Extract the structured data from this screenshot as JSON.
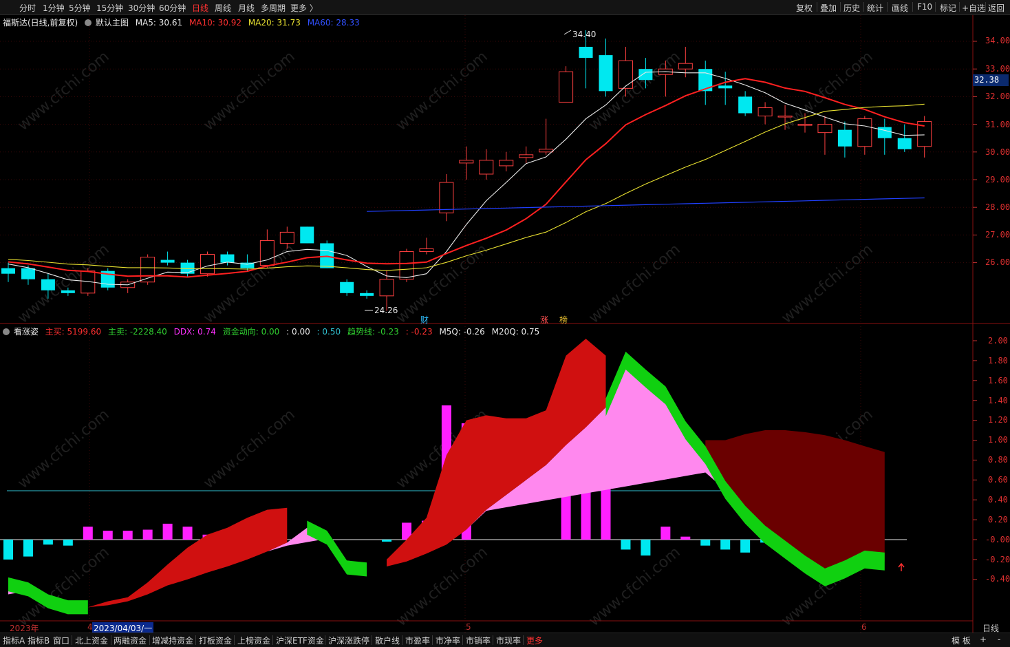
{
  "toolbar": {
    "periods": [
      "分时",
      "1分钟",
      "5分钟",
      "15分钟",
      "30分钟",
      "60分钟",
      "日线",
      "周线",
      "月线",
      "多周期",
      "更多 〉"
    ],
    "active_period": "日线",
    "right_items": [
      "复权",
      "叠加",
      "历史",
      "统计",
      "画线",
      "F10",
      "标记",
      "+自选",
      "返回"
    ]
  },
  "main_chart": {
    "stock_title": "福斯达(日线,前复权)",
    "template_label": "默认主图",
    "ma": [
      {
        "label": "MA5: 30.61",
        "color": "#e8e8e8"
      },
      {
        "label": "MA10: 30.92",
        "color": "#ff3030"
      },
      {
        "label": "MA20: 31.73",
        "color": "#e8e030"
      },
      {
        "label": "MA60: 28.33",
        "color": "#3050ff"
      }
    ],
    "high_label": "34.40",
    "low_label": "24.26",
    "current_price": "32.38",
    "price_axis": [
      "34.00",
      "33.00",
      "32.00",
      "31.00",
      "30.00",
      "29.00",
      "28.00",
      "27.00",
      "26.00"
    ],
    "markers": [
      "财",
      "涨",
      "榜"
    ]
  },
  "indicator": {
    "name": "看涨姿",
    "items": [
      {
        "label": "主买: 5199.60",
        "color": "#ff3030"
      },
      {
        "label": "主卖: -2228.40",
        "color": "#30d030"
      },
      {
        "label": "DDX: 0.74",
        "color": "#ff30ff"
      },
      {
        "label": "资金动向: 0.00",
        "color": "#30d030"
      },
      {
        "label": ": 0.00",
        "color": "#e8e8e8"
      },
      {
        "label": ": 0.50",
        "color": "#30c0d0"
      },
      {
        "label": "趋势线: -0.23",
        "color": "#30d030"
      },
      {
        "label": ": -0.23",
        "color": "#ff3030"
      },
      {
        "label": "M5Q: -0.26",
        "color": "#e8e8e8"
      },
      {
        "label": "M20Q: 0.75",
        "color": "#e8e8e8"
      }
    ],
    "axis": [
      "2.00",
      "1.80",
      "1.60",
      "1.40",
      "1.20",
      "1.00",
      "0.80",
      "0.60",
      "0.40",
      "0.20",
      "-0.00",
      "-0.20",
      "-0.40"
    ]
  },
  "dates": [
    "2023年",
    "4",
    "2023/04/03/一",
    "5",
    "6"
  ],
  "period_label": "日线",
  "bottom_tabs": [
    "指标A",
    "指标B",
    "窗口",
    "北上资金",
    "两融资金",
    "增减持资金",
    "打板资金",
    "上榜资金",
    "沪深ETF资金",
    "沪深涨跌停",
    "散户线",
    "市盈率",
    "市净率",
    "市销率",
    "市现率",
    "更多"
  ],
  "bottom_right": [
    "模 板",
    "+",
    "-"
  ],
  "watermark": "www.cfchi.com",
  "candles": [
    {
      "o": 25.8,
      "c": 25.6,
      "h": 26.0,
      "l": 25.3
    },
    {
      "o": 25.8,
      "c": 25.4,
      "h": 25.9,
      "l": 25.2
    },
    {
      "o": 25.4,
      "c": 25.0,
      "h": 25.6,
      "l": 24.7
    },
    {
      "o": 25.0,
      "c": 24.9,
      "h": 25.1,
      "l": 24.8
    },
    {
      "o": 24.9,
      "c": 25.7,
      "h": 25.8,
      "l": 24.8
    },
    {
      "o": 25.7,
      "c": 25.1,
      "h": 25.8,
      "l": 25.0
    },
    {
      "o": 25.1,
      "c": 25.3,
      "h": 25.4,
      "l": 24.9
    },
    {
      "o": 25.3,
      "c": 26.2,
      "h": 26.3,
      "l": 25.2
    },
    {
      "o": 26.1,
      "c": 26.0,
      "h": 26.4,
      "l": 25.9
    },
    {
      "o": 26.0,
      "c": 25.6,
      "h": 26.1,
      "l": 25.5
    },
    {
      "o": 25.6,
      "c": 26.3,
      "h": 26.4,
      "l": 25.5
    },
    {
      "o": 26.3,
      "c": 26.0,
      "h": 26.4,
      "l": 25.9
    },
    {
      "o": 26.0,
      "c": 25.8,
      "h": 26.3,
      "l": 25.7
    },
    {
      "o": 25.9,
      "c": 26.8,
      "h": 27.2,
      "l": 25.8
    },
    {
      "o": 26.7,
      "c": 27.1,
      "h": 27.3,
      "l": 26.5
    },
    {
      "o": 27.3,
      "c": 26.7,
      "h": 27.3,
      "l": 26.7
    },
    {
      "o": 26.7,
      "c": 25.8,
      "h": 26.8,
      "l": 25.8
    },
    {
      "o": 25.3,
      "c": 24.9,
      "h": 25.4,
      "l": 24.8
    },
    {
      "o": 24.9,
      "c": 24.8,
      "h": 25.0,
      "l": 24.7
    },
    {
      "o": 24.8,
      "c": 25.4,
      "h": 25.7,
      "l": 24.26
    },
    {
      "o": 25.4,
      "c": 26.4,
      "h": 26.5,
      "l": 25.3
    },
    {
      "o": 26.4,
      "c": 26.5,
      "h": 26.9,
      "l": 26.3
    },
    {
      "o": 27.8,
      "c": 28.9,
      "h": 29.2,
      "l": 27.5
    },
    {
      "o": 29.6,
      "c": 29.7,
      "h": 30.2,
      "l": 29.0
    },
    {
      "o": 29.2,
      "c": 29.7,
      "h": 30.1,
      "l": 29.0
    },
    {
      "o": 29.5,
      "c": 29.7,
      "h": 30.0,
      "l": 29.3
    },
    {
      "o": 29.8,
      "c": 29.9,
      "h": 30.2,
      "l": 29.6
    },
    {
      "o": 30.0,
      "c": 30.1,
      "h": 31.2,
      "l": 29.9
    },
    {
      "o": 31.8,
      "c": 32.9,
      "h": 33.1,
      "l": 31.8
    },
    {
      "o": 33.8,
      "c": 33.4,
      "h": 34.4,
      "l": 32.3
    },
    {
      "o": 33.5,
      "c": 32.2,
      "h": 34.1,
      "l": 32.0
    },
    {
      "o": 32.3,
      "c": 33.3,
      "h": 33.8,
      "l": 32.0
    },
    {
      "o": 33.0,
      "c": 32.6,
      "h": 33.4,
      "l": 32.3
    },
    {
      "o": 32.8,
      "c": 33.0,
      "h": 33.3,
      "l": 32.0
    },
    {
      "o": 33.0,
      "c": 33.2,
      "h": 33.8,
      "l": 32.7
    },
    {
      "o": 33.0,
      "c": 32.2,
      "h": 33.3,
      "l": 31.7
    },
    {
      "o": 32.4,
      "c": 32.3,
      "h": 32.9,
      "l": 31.7
    },
    {
      "o": 32.0,
      "c": 31.4,
      "h": 32.2,
      "l": 31.3
    },
    {
      "o": 31.3,
      "c": 31.6,
      "h": 31.8,
      "l": 31.0
    },
    {
      "o": 31.3,
      "c": 31.3,
      "h": 31.7,
      "l": 30.8
    },
    {
      "o": 31.0,
      "c": 31.0,
      "h": 31.4,
      "l": 30.7
    },
    {
      "o": 30.7,
      "c": 31.0,
      "h": 31.3,
      "l": 29.9
    },
    {
      "o": 30.8,
      "c": 30.2,
      "h": 31.1,
      "l": 29.8
    },
    {
      "o": 30.2,
      "c": 31.2,
      "h": 31.3,
      "l": 29.9
    },
    {
      "o": 30.9,
      "c": 30.5,
      "h": 31.2,
      "l": 29.9
    },
    {
      "o": 30.5,
      "c": 30.1,
      "h": 31.0,
      "l": 30.0
    },
    {
      "o": 30.2,
      "c": 31.1,
      "h": 31.3,
      "l": 29.8
    }
  ],
  "bars": [
    -0.2,
    -0.17,
    -0.05,
    -0.06,
    0.13,
    0.09,
    0.09,
    0.1,
    0.16,
    0.13,
    0.05,
    0.02,
    0.15,
    0.08,
    0.0,
    0.0,
    0.0,
    0.0,
    0.0,
    -0.02,
    0.17,
    0.19,
    1.35,
    1.17,
    0.0,
    0.0,
    0.0,
    0.0,
    1.65,
    0.98,
    0.68,
    -0.1,
    -0.16,
    0.13,
    0.03,
    -0.06,
    -0.1,
    -0.13,
    -0.03,
    -0.02,
    0.0,
    0.0,
    0.0,
    0.0,
    0.0,
    0.0,
    0.0
  ]
}
